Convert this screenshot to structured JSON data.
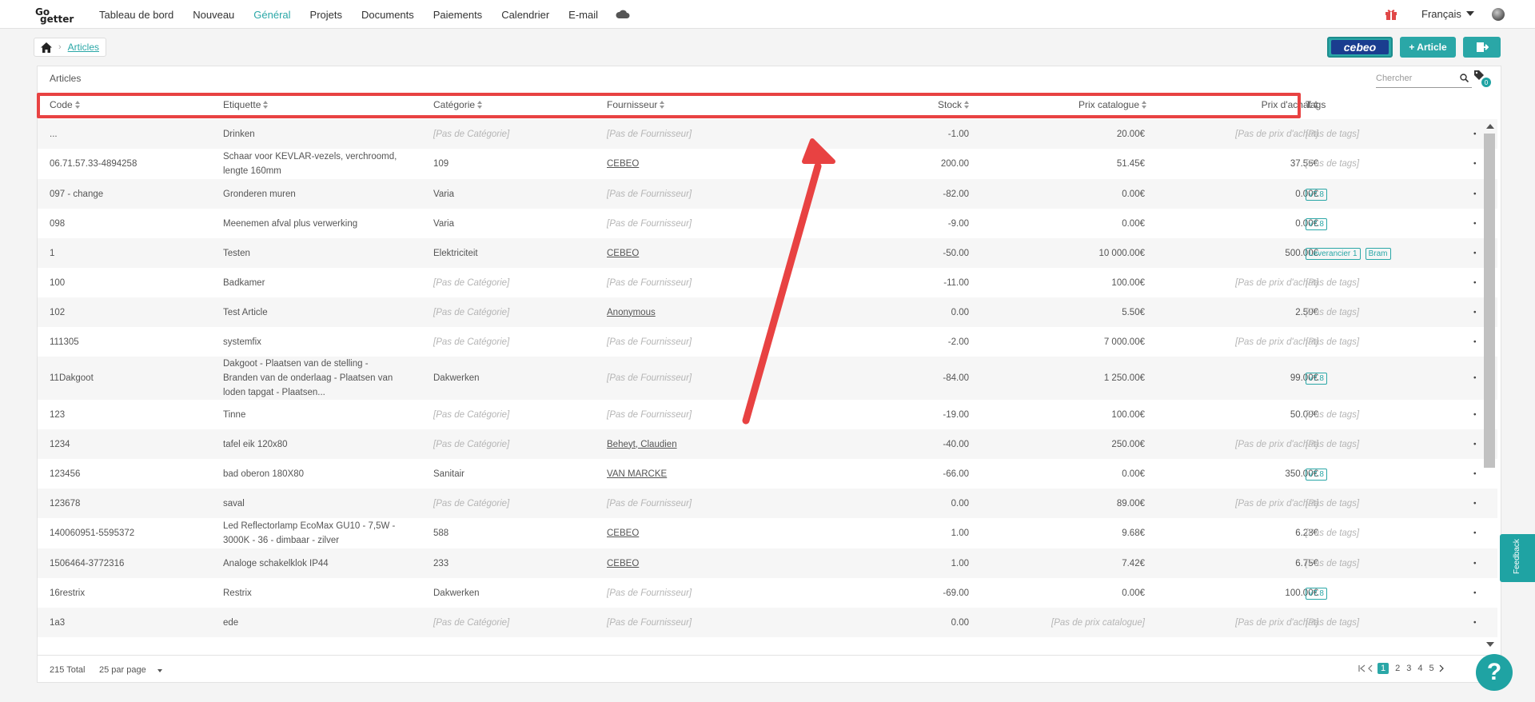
{
  "nav": {
    "logo_go": "Go",
    "logo_getter": "getter",
    "links": [
      "Tableau de bord",
      "Nouveau",
      "Général",
      "Projets",
      "Documents",
      "Paiements",
      "Calendrier",
      "E-mail"
    ],
    "active": "Général",
    "language": "Français"
  },
  "breadcrumb": {
    "current": "Articles"
  },
  "actions": {
    "cebeo_label": "cebeo",
    "add_article": "+ Article"
  },
  "panel": {
    "title": "Articles",
    "search_placeholder": "Chercher",
    "tag_badge": "0"
  },
  "columns": [
    "Code",
    "Etiquette",
    "Catégorie",
    "Fournisseur",
    "Stock",
    "Prix catalogue",
    "Prix d'achat",
    "Tags"
  ],
  "rows": [
    {
      "code": "...",
      "label": "Drinken",
      "category": "[Pas de Catégorie]",
      "supplier": "[Pas de Fournisseur]",
      "stock": "-1.00",
      "catalog": "20.00€",
      "purchase": "[Pas de prix d'achat]",
      "tags": [],
      "no_tags": "[Pas de tags]"
    },
    {
      "code": "06.71.57.33-4894258",
      "label": "Schaar voor KEVLAR-vezels, verchroomd, lengte 160mm",
      "category": "109",
      "supplier": "CEBEO",
      "stock": "200.00",
      "catalog": "51.45€",
      "purchase": "37.56€",
      "tags": [],
      "no_tags": "[Pas de tags]"
    },
    {
      "code": "097 - change",
      "label": "Gronderen muren",
      "category": "Varia",
      "supplier": "[Pas de Fournisseur]",
      "stock": "-82.00",
      "catalog": "0.00€",
      "purchase": "0.00€",
      "tags": [
        "v7.8"
      ],
      "no_tags": ""
    },
    {
      "code": "098",
      "label": "Meenemen afval plus verwerking",
      "category": "Varia",
      "supplier": "[Pas de Fournisseur]",
      "stock": "-9.00",
      "catalog": "0.00€",
      "purchase": "0.00€",
      "tags": [
        "v7.8"
      ],
      "no_tags": ""
    },
    {
      "code": "1",
      "label": "Testen",
      "category": "Elektriciteit",
      "supplier": "CEBEO",
      "stock": "-50.00",
      "catalog": "10 000.00€",
      "purchase": "500.00€",
      "tags": [
        "Leverancier 1",
        "Bram"
      ],
      "no_tags": ""
    },
    {
      "code": "100",
      "label": "Badkamer",
      "category": "[Pas de Catégorie]",
      "supplier": "[Pas de Fournisseur]",
      "stock": "-11.00",
      "catalog": "100.00€",
      "purchase": "[Pas de prix d'achat]",
      "tags": [],
      "no_tags": "[Pas de tags]"
    },
    {
      "code": "102",
      "label": "Test Article",
      "category": "[Pas de Catégorie]",
      "supplier": "Anonymous",
      "stock": "0.00",
      "catalog": "5.50€",
      "purchase": "2.50€",
      "tags": [],
      "no_tags": "[Pas de tags]"
    },
    {
      "code": "111305",
      "label": "systemfix",
      "category": "[Pas de Catégorie]",
      "supplier": "[Pas de Fournisseur]",
      "stock": "-2.00",
      "catalog": "7 000.00€",
      "purchase": "[Pas de prix d'achat]",
      "tags": [],
      "no_tags": "[Pas de tags]"
    },
    {
      "code": "11Dakgoot",
      "label": "Dakgoot - Plaatsen van de stelling - Branden van de onderlaag - Plaatsen van loden tapgat - Plaatsen...",
      "category": "Dakwerken",
      "supplier": "[Pas de Fournisseur]",
      "stock": "-84.00",
      "catalog": "1 250.00€",
      "purchase": "99.00€",
      "tags": [
        "v7.8"
      ],
      "no_tags": ""
    },
    {
      "code": "123",
      "label": "Tinne",
      "category": "[Pas de Catégorie]",
      "supplier": "[Pas de Fournisseur]",
      "stock": "-19.00",
      "catalog": "100.00€",
      "purchase": "50.00€",
      "tags": [],
      "no_tags": "[Pas de tags]"
    },
    {
      "code": "1234",
      "label": "tafel eik 120x80",
      "category": "[Pas de Catégorie]",
      "supplier": "Beheyt, Claudien",
      "stock": "-40.00",
      "catalog": "250.00€",
      "purchase": "[Pas de prix d'achat]",
      "tags": [],
      "no_tags": "[Pas de tags]"
    },
    {
      "code": "123456",
      "label": "bad oberon 180X80",
      "category": "Sanitair",
      "supplier": "VAN MARCKE",
      "stock": "-66.00",
      "catalog": "0.00€",
      "purchase": "350.00€",
      "tags": [
        "v7.8"
      ],
      "no_tags": ""
    },
    {
      "code": "123678",
      "label": "saval",
      "category": "[Pas de Catégorie]",
      "supplier": "[Pas de Fournisseur]",
      "stock": "0.00",
      "catalog": "89.00€",
      "purchase": "[Pas de prix d'achat]",
      "tags": [],
      "no_tags": "[Pas de tags]"
    },
    {
      "code": "140060951-5595372",
      "label": "Led Reflectorlamp EcoMax GU10 - 7,5W - 3000K - 36 - dimbaar - zilver",
      "category": "588",
      "supplier": "CEBEO",
      "stock": "1.00",
      "catalog": "9.68€",
      "purchase": "6.23€",
      "tags": [],
      "no_tags": "[Pas de tags]"
    },
    {
      "code": "1506464-3772316",
      "label": "Analoge schakelklok IP44",
      "category": "233",
      "supplier": "CEBEO",
      "stock": "1.00",
      "catalog": "7.42€",
      "purchase": "6.75€",
      "tags": [],
      "no_tags": "[Pas de tags]"
    },
    {
      "code": "16restrix",
      "label": "Restrix",
      "category": "Dakwerken",
      "supplier": "[Pas de Fournisseur]",
      "stock": "-69.00",
      "catalog": "0.00€",
      "purchase": "100.00€",
      "tags": [
        "v7.8"
      ],
      "no_tags": ""
    },
    {
      "code": "1a3",
      "label": "ede",
      "category": "[Pas de Catégorie]",
      "supplier": "[Pas de Fournisseur]",
      "stock": "0.00",
      "catalog": "[Pas de prix catalogue]",
      "purchase": "[Pas de prix d'achat]",
      "tags": [],
      "no_tags": "[Pas de tags]"
    }
  ],
  "footer": {
    "total": "215 Total",
    "per_page": "25 par page",
    "pages": [
      "1",
      "2",
      "3",
      "4",
      "5"
    ],
    "current_page": "1"
  },
  "feedback_label": "Feedback",
  "help_label": "?",
  "colors": {
    "accent": "#2aa7a7",
    "highlight": "#e84242"
  }
}
